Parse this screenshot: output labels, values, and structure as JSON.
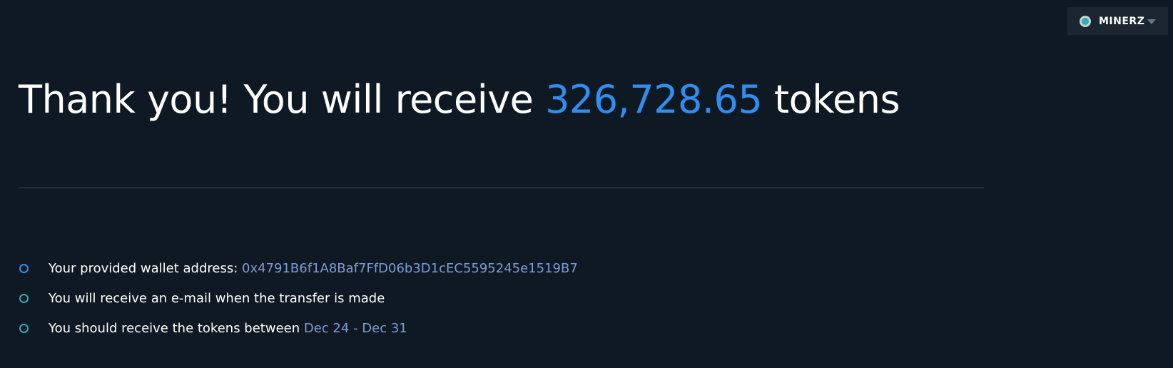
{
  "colors": {
    "background": "#0f1923",
    "accent_blue": "#2f8ef0",
    "accent_teal": "#2aaeb3",
    "muted_highlight": "#7f9bd4"
  },
  "account_menu": {
    "name": "MINERZ",
    "status_icon": "status-dot-icon",
    "dropdown_icon": "chevron-down-icon"
  },
  "headline": {
    "prefix": "Thank you! You will receive",
    "amount": "326,728.65",
    "suffix": "tokens"
  },
  "info_items": [
    {
      "icon": "circle-outline-icon",
      "label": "Your provided wallet address:",
      "value": "0x4791B6f1A8Baf7FfD06b3D1cEC5595245e1519B7"
    },
    {
      "icon": "circle-outline-icon",
      "label": "You will receive an e-mail when the transfer is made",
      "value": ""
    },
    {
      "icon": "circle-outline-icon",
      "label": "You should receive the tokens between",
      "value": "Dec 24 - Dec 31"
    }
  ]
}
